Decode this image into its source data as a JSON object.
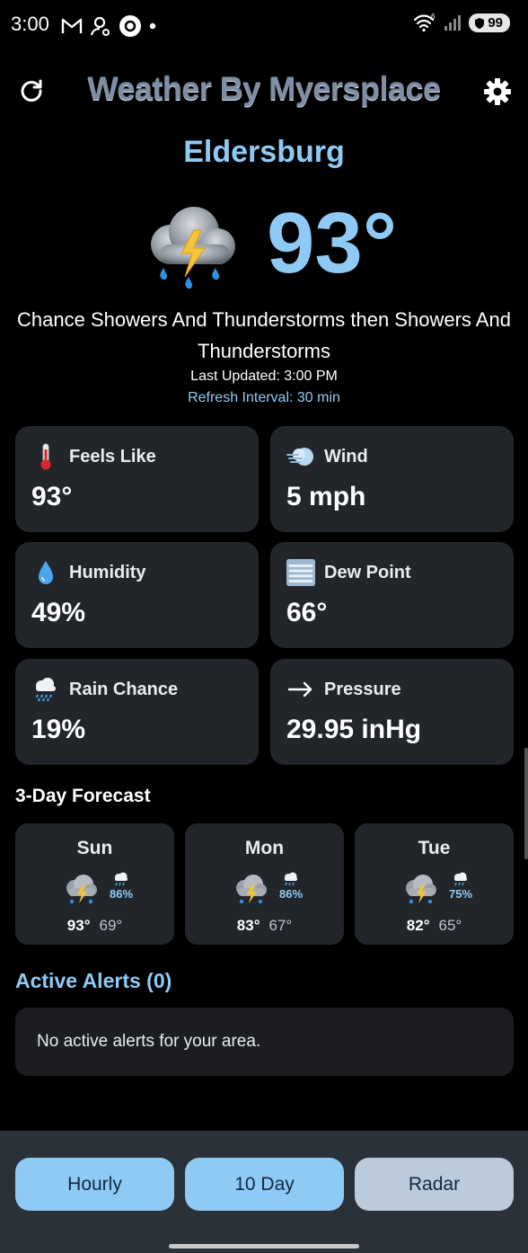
{
  "status_bar": {
    "time": "3:00",
    "left_icons": [
      "gmail-icon",
      "account-icon",
      "media-icon",
      "dot-icon"
    ],
    "right_icons": [
      "wifi-icon",
      "signal-icon"
    ],
    "wifi_label": "6",
    "battery": "99"
  },
  "header": {
    "title": "Weather By Myersplace",
    "refresh_icon": "refresh-icon",
    "settings_icon": "gear-icon"
  },
  "location": {
    "city": "Eldersburg"
  },
  "current": {
    "icon": "thunderstorm-icon",
    "temperature": "93°",
    "condition": "Chance Showers And Thunderstorms then Showers And Thunderstorms",
    "last_updated": "Last Updated: 3:00 PM",
    "refresh_interval": "Refresh Interval: 30 min"
  },
  "cards": [
    {
      "label": "Feels Like",
      "value": "93°",
      "icon": "thermometer-icon"
    },
    {
      "label": "Wind",
      "value": "5 mph",
      "icon": "wind-icon"
    },
    {
      "label": "Humidity",
      "value": "49%",
      "icon": "droplet-icon"
    },
    {
      "label": "Dew Point",
      "value": "66°",
      "icon": "fog-icon"
    },
    {
      "label": "Rain Chance",
      "value": "19%",
      "icon": "rain-cloud-icon"
    },
    {
      "label": "Pressure",
      "value": "29.95 inHg",
      "icon": "arrow-right-icon"
    }
  ],
  "forecast": {
    "title": "3-Day Forecast",
    "days": [
      {
        "name": "Sun",
        "rain_chance": "86%",
        "high": "93°",
        "low": "69°"
      },
      {
        "name": "Mon",
        "rain_chance": "86%",
        "high": "83°",
        "low": "67°"
      },
      {
        "name": "Tue",
        "rain_chance": "75%",
        "high": "82°",
        "low": "65°"
      }
    ]
  },
  "alerts": {
    "title": "Active Alerts (0)",
    "empty_message": "No active alerts for your area."
  },
  "nav": {
    "hourly": "Hourly",
    "ten_day": "10 Day",
    "radar": "Radar"
  },
  "colors": {
    "accent": "#8fcaf5",
    "card_bg": "#22262b",
    "background": "#000000",
    "nav_bar": "#2a3138",
    "radar_button": "#bccbdb"
  }
}
